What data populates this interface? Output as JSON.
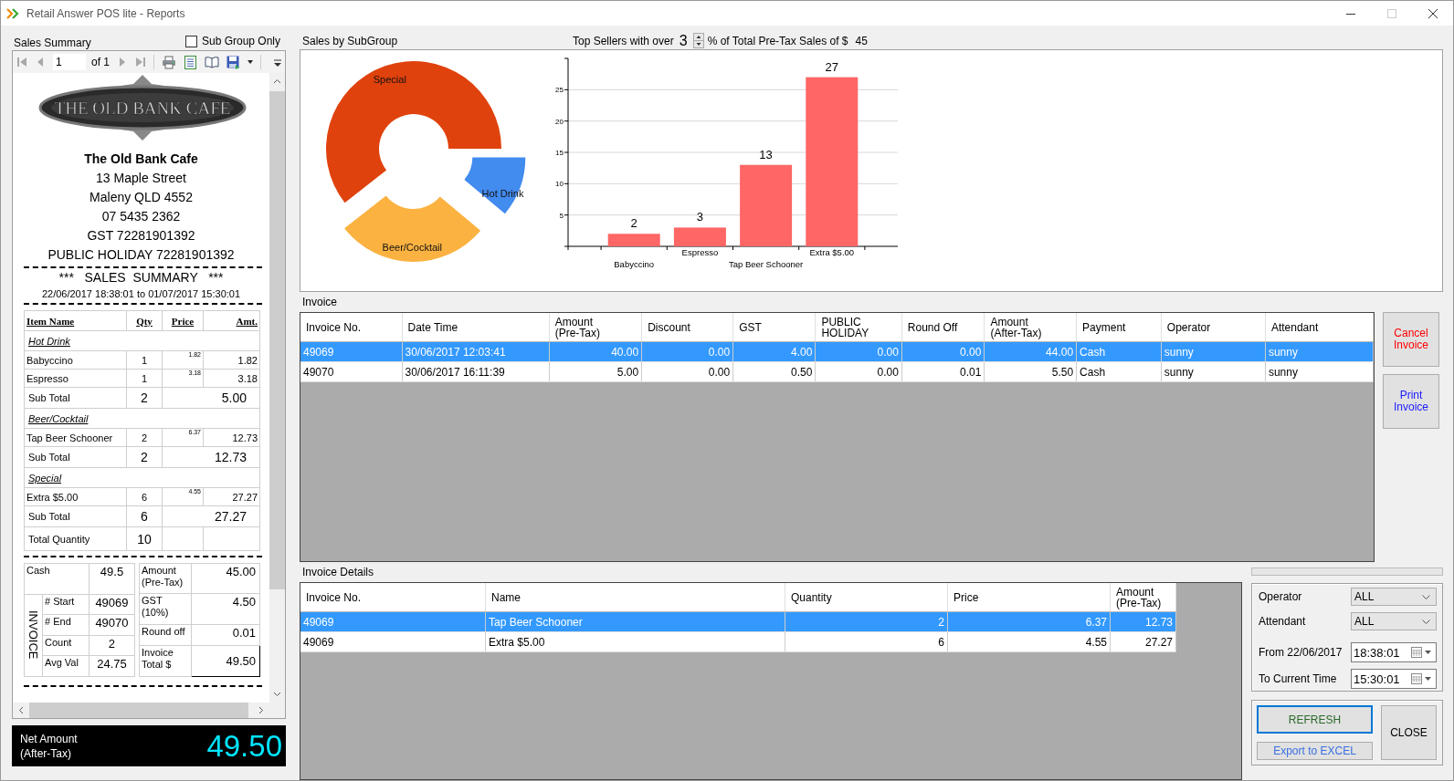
{
  "window": {
    "title": "Retail Answer POS lite - Reports"
  },
  "sales_summary": {
    "label": "Sales Summary",
    "sub_group_only": {
      "label": "Sub Group Only",
      "checked": false
    },
    "viewer": {
      "page": "1",
      "of_label": "of 1"
    },
    "report": {
      "logo_text": "THE OLD BANK CAFE",
      "business_lines": [
        "The Old Bank Cafe",
        "13 Maple Street",
        "Maleny QLD 4552",
        "07 5435 2362",
        "GST 72281901392",
        "PUBLIC HOLIDAY 72281901392"
      ],
      "title": "***   SALES  SUMMARY   ***",
      "period": "22/06/2017 18:38:01 to 01/07/2017 15:30:01",
      "columns": [
        "Item Name",
        "Qty",
        "Price",
        "Amt."
      ],
      "rows": [
        {
          "kind": "group",
          "name": "Hot Drink"
        },
        {
          "kind": "item",
          "name": "Babyccino",
          "qty": "1",
          "price": "1.82",
          "amount": "1.82"
        },
        {
          "kind": "item",
          "name": "Espresso",
          "qty": "1",
          "price": "3.18",
          "amount": "3.18"
        },
        {
          "kind": "subtotal",
          "name": "Sub Total",
          "qty": "2",
          "amount": "5.00"
        },
        {
          "kind": "group",
          "name": "Beer/Cocktail"
        },
        {
          "kind": "item",
          "name": "Tap Beer Schooner",
          "qty": "2",
          "price": "6.37",
          "amount": "12.73"
        },
        {
          "kind": "subtotal",
          "name": "Sub Total",
          "qty": "2",
          "amount": "12.73"
        },
        {
          "kind": "group",
          "name": "Special"
        },
        {
          "kind": "item",
          "name": "Extra $5.00",
          "qty": "6",
          "price": "4.55",
          "amount": "27.27"
        },
        {
          "kind": "subtotal",
          "name": "Sub Total",
          "qty": "6",
          "amount": "27.27"
        },
        {
          "kind": "total",
          "name": "Total Quantity",
          "qty": "10"
        }
      ],
      "payment": {
        "label": "Cash",
        "value": "49.5"
      },
      "invoice_label": "INVOICE",
      "invoice_stats": [
        {
          "label": "# Start",
          "value": "49069"
        },
        {
          "label": "# End",
          "value": "49070"
        },
        {
          "label": "Count",
          "value": "2"
        },
        {
          "label": "Avg Val",
          "value": "24.75"
        }
      ],
      "totals": [
        {
          "label": "Amount\n(Pre-Tax)",
          "value": "45.00",
          "boxed": false
        },
        {
          "label": "GST\n(10%)",
          "value": "4.50",
          "boxed": false
        },
        {
          "label": "Round off",
          "value": "0.01",
          "boxed": false
        },
        {
          "label": "Invoice\nTotal $",
          "value": "49.50",
          "boxed": true
        }
      ]
    },
    "net_amount": {
      "label": "Net Amount\n(After-Tax)",
      "value": "49.50"
    }
  },
  "sales_by_subgroup": {
    "label": "Sales by SubGroup",
    "top_sellers": {
      "prefix": "Top Sellers with over",
      "value": "3",
      "suffix": "% of Total Pre-Tax Sales of $",
      "total": "45"
    },
    "donut": {
      "segments": [
        {
          "label": "Special",
          "color": "#e0420d"
        },
        {
          "label": "Beer/Cocktail",
          "color": "#fbb241"
        },
        {
          "label": "Hot Drink",
          "color": "#428bef"
        }
      ]
    },
    "chart_data": {
      "type": "bar",
      "categories": [
        "Babyccino",
        "Espresso",
        "Tap Beer Schooner",
        "Extra $5.00"
      ],
      "series": [
        {
          "color": "#ff6666",
          "values": [
            2,
            3,
            13,
            27
          ]
        }
      ],
      "ylim": [
        0,
        30
      ],
      "yticks": [
        5,
        10,
        15,
        20,
        25
      ],
      "grid": true,
      "data_labels": true
    }
  },
  "invoice": {
    "label": "Invoice",
    "columns": [
      "Invoice No.",
      "Date Time",
      "Amount\n(Pre-Tax)",
      "Discount",
      "GST",
      "PUBLIC\nHOLIDAY",
      "Round Off",
      "Amount\n(After-Tax)",
      "Payment",
      "Operator",
      "Attendant"
    ],
    "rows": [
      {
        "selected": true,
        "cells": [
          "49069",
          "30/06/2017 12:03:41",
          "40.00",
          "0.00",
          "4.00",
          "0.00",
          "0.00",
          "44.00",
          "Cash",
          "sunny",
          "sunny"
        ]
      },
      {
        "selected": false,
        "cells": [
          "49070",
          "30/06/2017 16:11:39",
          "5.00",
          "0.00",
          "0.50",
          "0.00",
          "0.01",
          "5.50",
          "Cash",
          "sunny",
          "sunny"
        ]
      }
    ]
  },
  "cancel_invoice_button": "Cancel\nInvoice",
  "print_invoice_button": "Print\nInvoice",
  "invoice_details": {
    "label": "Invoice Details",
    "columns": [
      "Invoice No.",
      "Name",
      "Quantity",
      "Price",
      "Amount\n(Pre-Tax)"
    ],
    "rows": [
      {
        "selected": true,
        "cells": [
          "49069",
          "Tap Beer Schooner",
          "2",
          "6.37",
          "12.73"
        ]
      },
      {
        "selected": false,
        "cells": [
          "49069",
          "Extra $5.00",
          "6",
          "4.55",
          "27.27"
        ]
      }
    ]
  },
  "progress": {
    "level": 0
  },
  "filters": {
    "operator": {
      "label": "Operator",
      "value": "ALL"
    },
    "attendant": {
      "label": "Attendant",
      "value": "ALL"
    },
    "from": {
      "label": "From 22/06/2017",
      "value": "18:38:01"
    },
    "to": {
      "label": "To Current Time",
      "value": "15:30:01"
    }
  },
  "buttons": {
    "refresh": {
      "label": "REFRESH",
      "focused": true
    },
    "export": "Export to EXCEL",
    "close": "CLOSE"
  }
}
